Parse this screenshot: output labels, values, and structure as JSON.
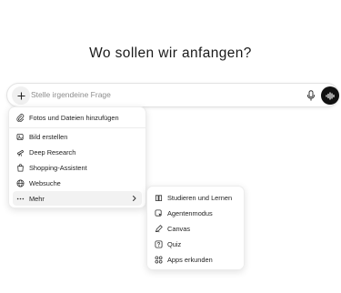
{
  "heading": "Wo sollen wir anfangen?",
  "composer": {
    "placeholder": "Stelle irgendeine Frage"
  },
  "menu": {
    "upload_label": "Fotos und Dateien hinzufügen",
    "items": [
      {
        "label": "Bild erstellen",
        "icon": "image-create-icon"
      },
      {
        "label": "Deep Research",
        "icon": "telescope-icon"
      },
      {
        "label": "Shopping-Assistent",
        "icon": "shopping-bag-icon"
      },
      {
        "label": "Websuche",
        "icon": "globe-icon"
      }
    ],
    "more_label": "Mehr"
  },
  "submenu": {
    "items": [
      {
        "label": "Studieren und Lernen",
        "icon": "book-icon"
      },
      {
        "label": "Agentenmodus",
        "icon": "agent-icon"
      },
      {
        "label": "Canvas",
        "icon": "pen-icon"
      },
      {
        "label": "Quiz",
        "icon": "quiz-icon"
      },
      {
        "label": "Apps erkunden",
        "icon": "apps-icon"
      }
    ]
  },
  "colors": {
    "highlight": "#fff200",
    "voice_button": "#111111",
    "hover_bg": "#f2f2f2"
  }
}
